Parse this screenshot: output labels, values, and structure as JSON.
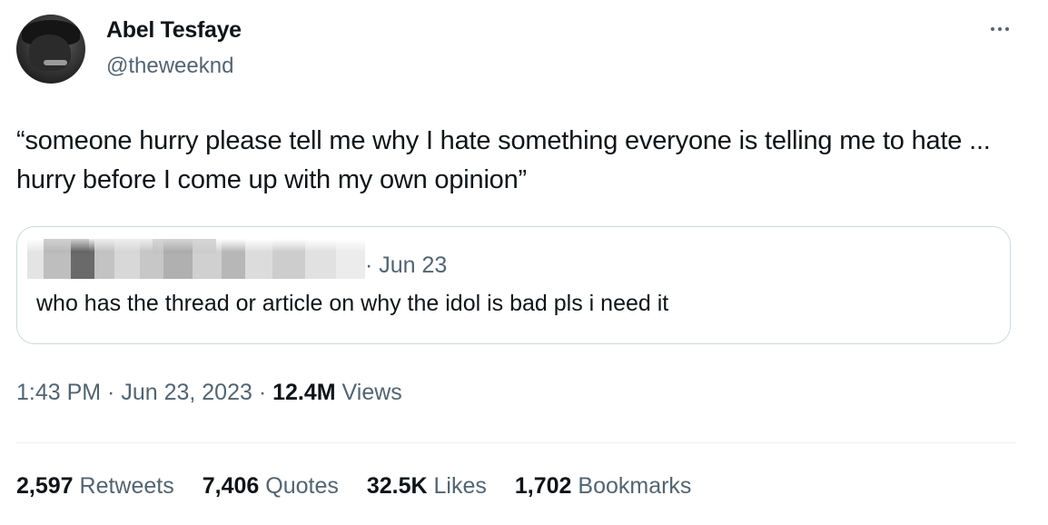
{
  "tweet": {
    "display_name": "Abel Tesfaye",
    "handle": "@theweeknd",
    "text": "“someone hurry please tell me why I hate something everyone is telling me to hate ... hurry before I come up with my own opinion”",
    "more_icon": "more-horizontal-icon"
  },
  "quoted": {
    "meta": "· Jun 23",
    "text": "who has the thread or article on why the idol is bad pls i need it"
  },
  "timestamp": {
    "time": "1:43 PM",
    "sep1": " · ",
    "date": "Jun 23, 2023",
    "sep2": " · ",
    "views_count": "12.4M",
    "views_label": " Views"
  },
  "stats": [
    {
      "count": "2,597",
      "label": " Retweets"
    },
    {
      "count": "7,406",
      "label": " Quotes"
    },
    {
      "count": "32.5K",
      "label": " Likes"
    },
    {
      "count": "1,702",
      "label": " Bookmarks"
    }
  ],
  "colors": {
    "text": "#0f1419",
    "secondary": "#536471",
    "border": "#cfd9de"
  }
}
